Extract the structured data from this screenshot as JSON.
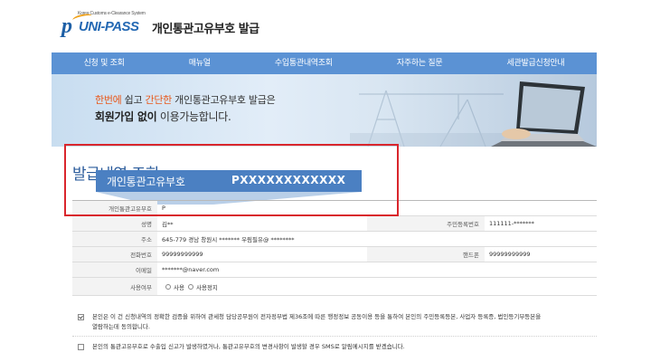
{
  "header": {
    "logo_tagline": "Korea Customs e-Clearance System",
    "logo_p": "p",
    "logo_text": "UNI-PASS",
    "title": "개인통관고유부호 발급"
  },
  "nav": {
    "items": [
      {
        "label": "신청 및 조회"
      },
      {
        "label": "매뉴얼"
      },
      {
        "label": "수입통관내역조회"
      },
      {
        "label": "자주하는 질문"
      },
      {
        "label": "세관발급신청안내"
      }
    ]
  },
  "banner": {
    "line1_a": "한번에",
    "line1_b": " 쉽고 ",
    "line1_c": "간단한",
    "line1_d": " 개인통관고유부호 발급은",
    "line2_a": "회원가입 없이",
    "line2_b": " 이용가능합니다."
  },
  "page_title": "발급내역 조회",
  "callout": {
    "label": "개인통관고유부호",
    "value": "PXXXXXXXXXXXX"
  },
  "form": {
    "customs_code": {
      "label": "개인통관고유부호",
      "value": "P"
    },
    "name": {
      "label": "성명",
      "value": "김**"
    },
    "resident_no": {
      "label": "주민등록번호",
      "value": "111111-*******"
    },
    "address": {
      "label": "주소",
      "value": "645-779  경남 창원시 ******* 우림필유@ ********"
    },
    "phone": {
      "label": "전화번호",
      "value": "99999999999"
    },
    "mobile": {
      "label": "핸드폰",
      "value": "99999999999"
    },
    "email": {
      "label": "이메일",
      "value": "*******@naver.com"
    },
    "usage": {
      "label": "사용여부",
      "option_use": "사용",
      "option_stop": "사용정지"
    }
  },
  "consent": {
    "item1_line1": "본인은 이 건 신청내역의 정확한 검증을 위하여 관세청 담당공무원이 전자정부법 제36조에 따른 행정정보 공동이용 등을 통하여 본인의 주민등록등본, 사업자 등록증, 법인등기부등본을",
    "item1_line2": "열람하는데 동의합니다.",
    "item2": "본인의 통관고유부호로 수출입 신고가 발생하였거나, 통관고유부호의 변경사항이 발생할 경우 SMS로 알림메시지를 받겠습니다."
  },
  "colors": {
    "nav_bg": "#5b92d4",
    "callout_bg": "#4b80c2",
    "frame_red": "#d9262c",
    "title_blue": "#2b5c9c",
    "accent_orange": "#e8591c"
  }
}
